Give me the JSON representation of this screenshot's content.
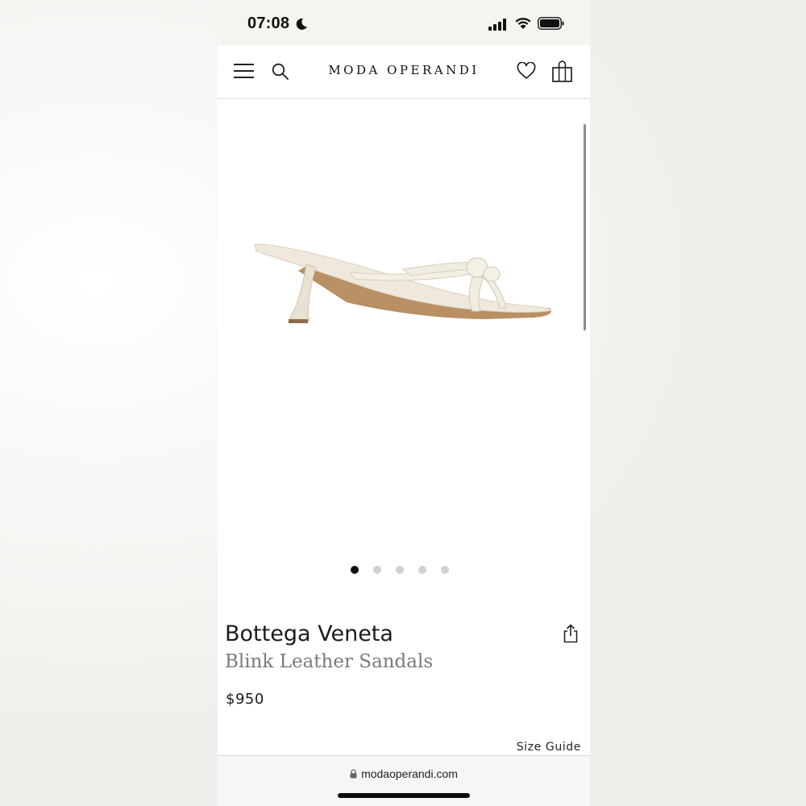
{
  "status_bar": {
    "time": "07:08",
    "icons": [
      "moon-icon",
      "signal-icon",
      "wifi-icon",
      "battery-icon"
    ]
  },
  "header": {
    "brand": "MODA OPERANDI",
    "icons": [
      "menu-icon",
      "search-icon",
      "heart-icon",
      "bag-icon"
    ]
  },
  "gallery": {
    "image": "sandal-image",
    "image_count": 5,
    "active_index": 0
  },
  "product": {
    "designer": "Bottega Veneta",
    "name": "Blink Leather Sandals",
    "price": "$950",
    "size_guide_label": "Size Guide",
    "share_icon": "share-icon"
  },
  "browser": {
    "url": "modaoperandi.com"
  },
  "colors": {
    "text": "#1b1b1b",
    "muted": "#7a7a7a",
    "dot_active": "#111111",
    "dot_inactive": "#d0d0d0",
    "status_bg": "#f6f4ef"
  }
}
